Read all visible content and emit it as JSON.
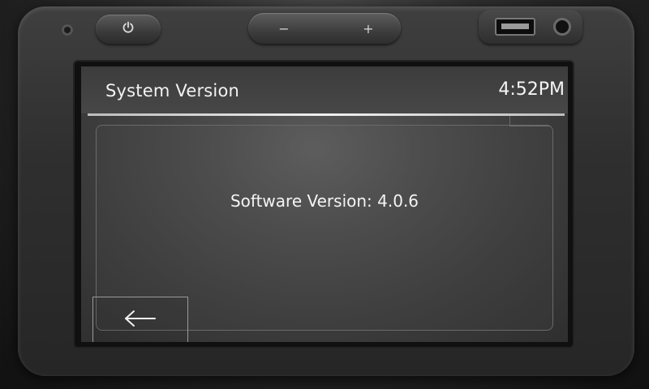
{
  "header": {
    "title": "System Version",
    "time": "4:52PM"
  },
  "main": {
    "software_version_text": "Software Version: 4.0.6"
  },
  "hardware": {
    "volume_minus_label": "−",
    "volume_plus_label": "+"
  },
  "icons": {
    "back": "left-arrow",
    "power": "power-symbol",
    "usb": "usb-port",
    "aux": "aux-jack",
    "indicator": "sensor-dot"
  },
  "colors": {
    "screen_background": "#4a4a4a",
    "text": "#f4f4f4",
    "divider": "#e8e8e8"
  }
}
